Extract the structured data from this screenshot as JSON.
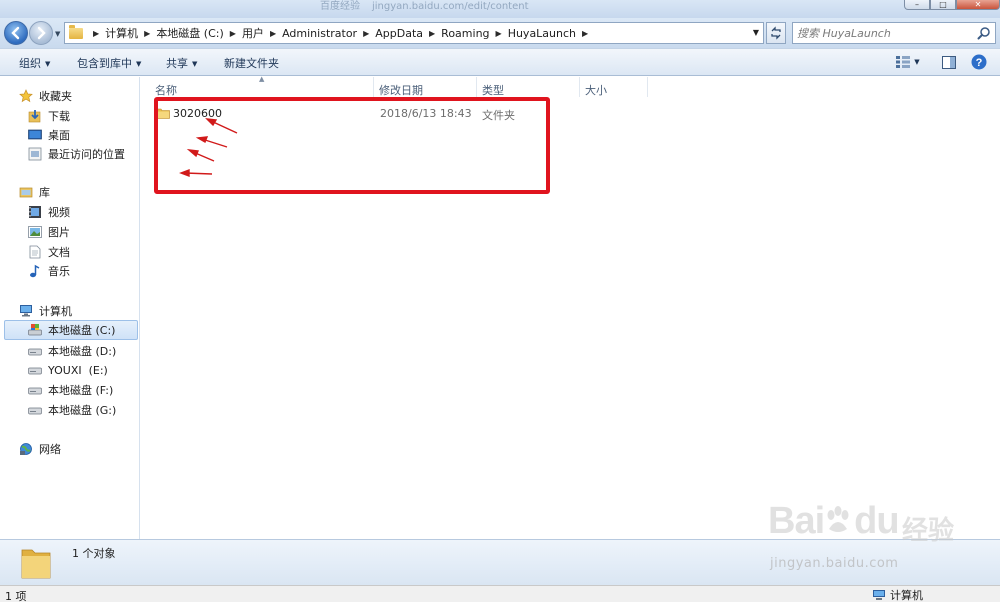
{
  "titlebar": {
    "ghost_text": [
      "百度经验",
      "jingyan.baidu.com/edit/content"
    ],
    "controls": {
      "minimize": "–",
      "maximize": "□",
      "close": "✕"
    }
  },
  "address": {
    "crumbs": [
      "计算机",
      "本地磁盘 (C:)",
      "用户",
      "Administrator",
      "AppData",
      "Roaming",
      "HuyaLaunch"
    ],
    "search_placeholder": "搜索 HuyaLaunch"
  },
  "toolbar": {
    "organize": "组织",
    "include_in_library": "包含到库中",
    "share": "共享",
    "new_folder": "新建文件夹"
  },
  "nav": {
    "favorites": {
      "label": "收藏夹",
      "items": [
        "下载",
        "桌面",
        "最近访问的位置"
      ]
    },
    "libraries": {
      "label": "库",
      "items": [
        "视频",
        "图片",
        "文档",
        "音乐"
      ]
    },
    "computer": {
      "label": "计算机",
      "drives": [
        "本地磁盘 (C:)",
        "本地磁盘 (D:)",
        "YOUXI  (E:)",
        "本地磁盘 (F:)",
        "本地磁盘 (G:)"
      ],
      "selected": "本地磁盘 (C:)"
    },
    "network": {
      "label": "网络"
    }
  },
  "columns": {
    "name": "名称",
    "modified": "修改日期",
    "type": "类型",
    "size": "大小"
  },
  "files": [
    {
      "name": "3020600",
      "modified": "2018/6/13 18:43",
      "type": "文件夹",
      "size": ""
    }
  ],
  "details": {
    "count_text": "1 个对象"
  },
  "status": {
    "left": "1 项",
    "right": "计算机"
  },
  "watermark": {
    "brand": "Bai",
    "brand2": "du",
    "cn": "经验",
    "url": "jingyan.baidu.com"
  },
  "colors": {
    "highlight_box": "#e0141e",
    "folder": "#e8bc4a",
    "toolbar_text": "#1e3657"
  }
}
